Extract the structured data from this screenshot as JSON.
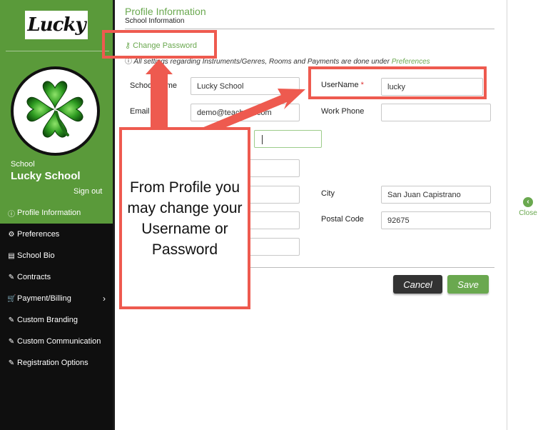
{
  "sidebar": {
    "logo_text": "Lucky",
    "school_label": "School",
    "school_name": "Lucky School",
    "signout_label": "Sign out",
    "items": [
      {
        "label": "Profile Information",
        "icon": "info-circle-icon",
        "active": true
      },
      {
        "label": "Preferences",
        "icon": "gears-icon"
      },
      {
        "label": "School Bio",
        "icon": "document-icon"
      },
      {
        "label": "Contracts",
        "icon": "pencil-icon"
      },
      {
        "label": "Payment/Billing",
        "icon": "cart-icon"
      },
      {
        "label": "Custom Branding",
        "icon": "pencil-icon"
      },
      {
        "label": "Custom Communication",
        "icon": "pencil-icon"
      },
      {
        "label": "Registration Options",
        "icon": "pencil-icon"
      }
    ]
  },
  "header": {
    "title": "Profile Information",
    "subtitle": "School Information"
  },
  "change_password_label": "Change Password",
  "info": {
    "text": "All settings regarding Instruments/Genres, Rooms and Payments are done under",
    "link": "Preferences"
  },
  "form": {
    "school_name": {
      "label": "School Name",
      "value": "Lucky School"
    },
    "email": {
      "label": "Email",
      "value": "demo@teachme.com"
    },
    "username": {
      "label": "UserName",
      "required_mark": "*",
      "value": "lucky"
    },
    "work_phone": {
      "label": "Work Phone",
      "value": ""
    },
    "city": {
      "label": "City",
      "value": "San Juan Capistrano"
    },
    "postal_code": {
      "label": "Postal Code",
      "value": "92675"
    }
  },
  "buttons": {
    "cancel": "Cancel",
    "save": "Save"
  },
  "close_label": "Close",
  "annotation": {
    "callout_text": "From Profile you may change your Username or Password"
  },
  "colors": {
    "brand_green": "#6aa84f",
    "sidebar_green": "#5a9a3a",
    "annotation_red": "#ee5a4f"
  }
}
